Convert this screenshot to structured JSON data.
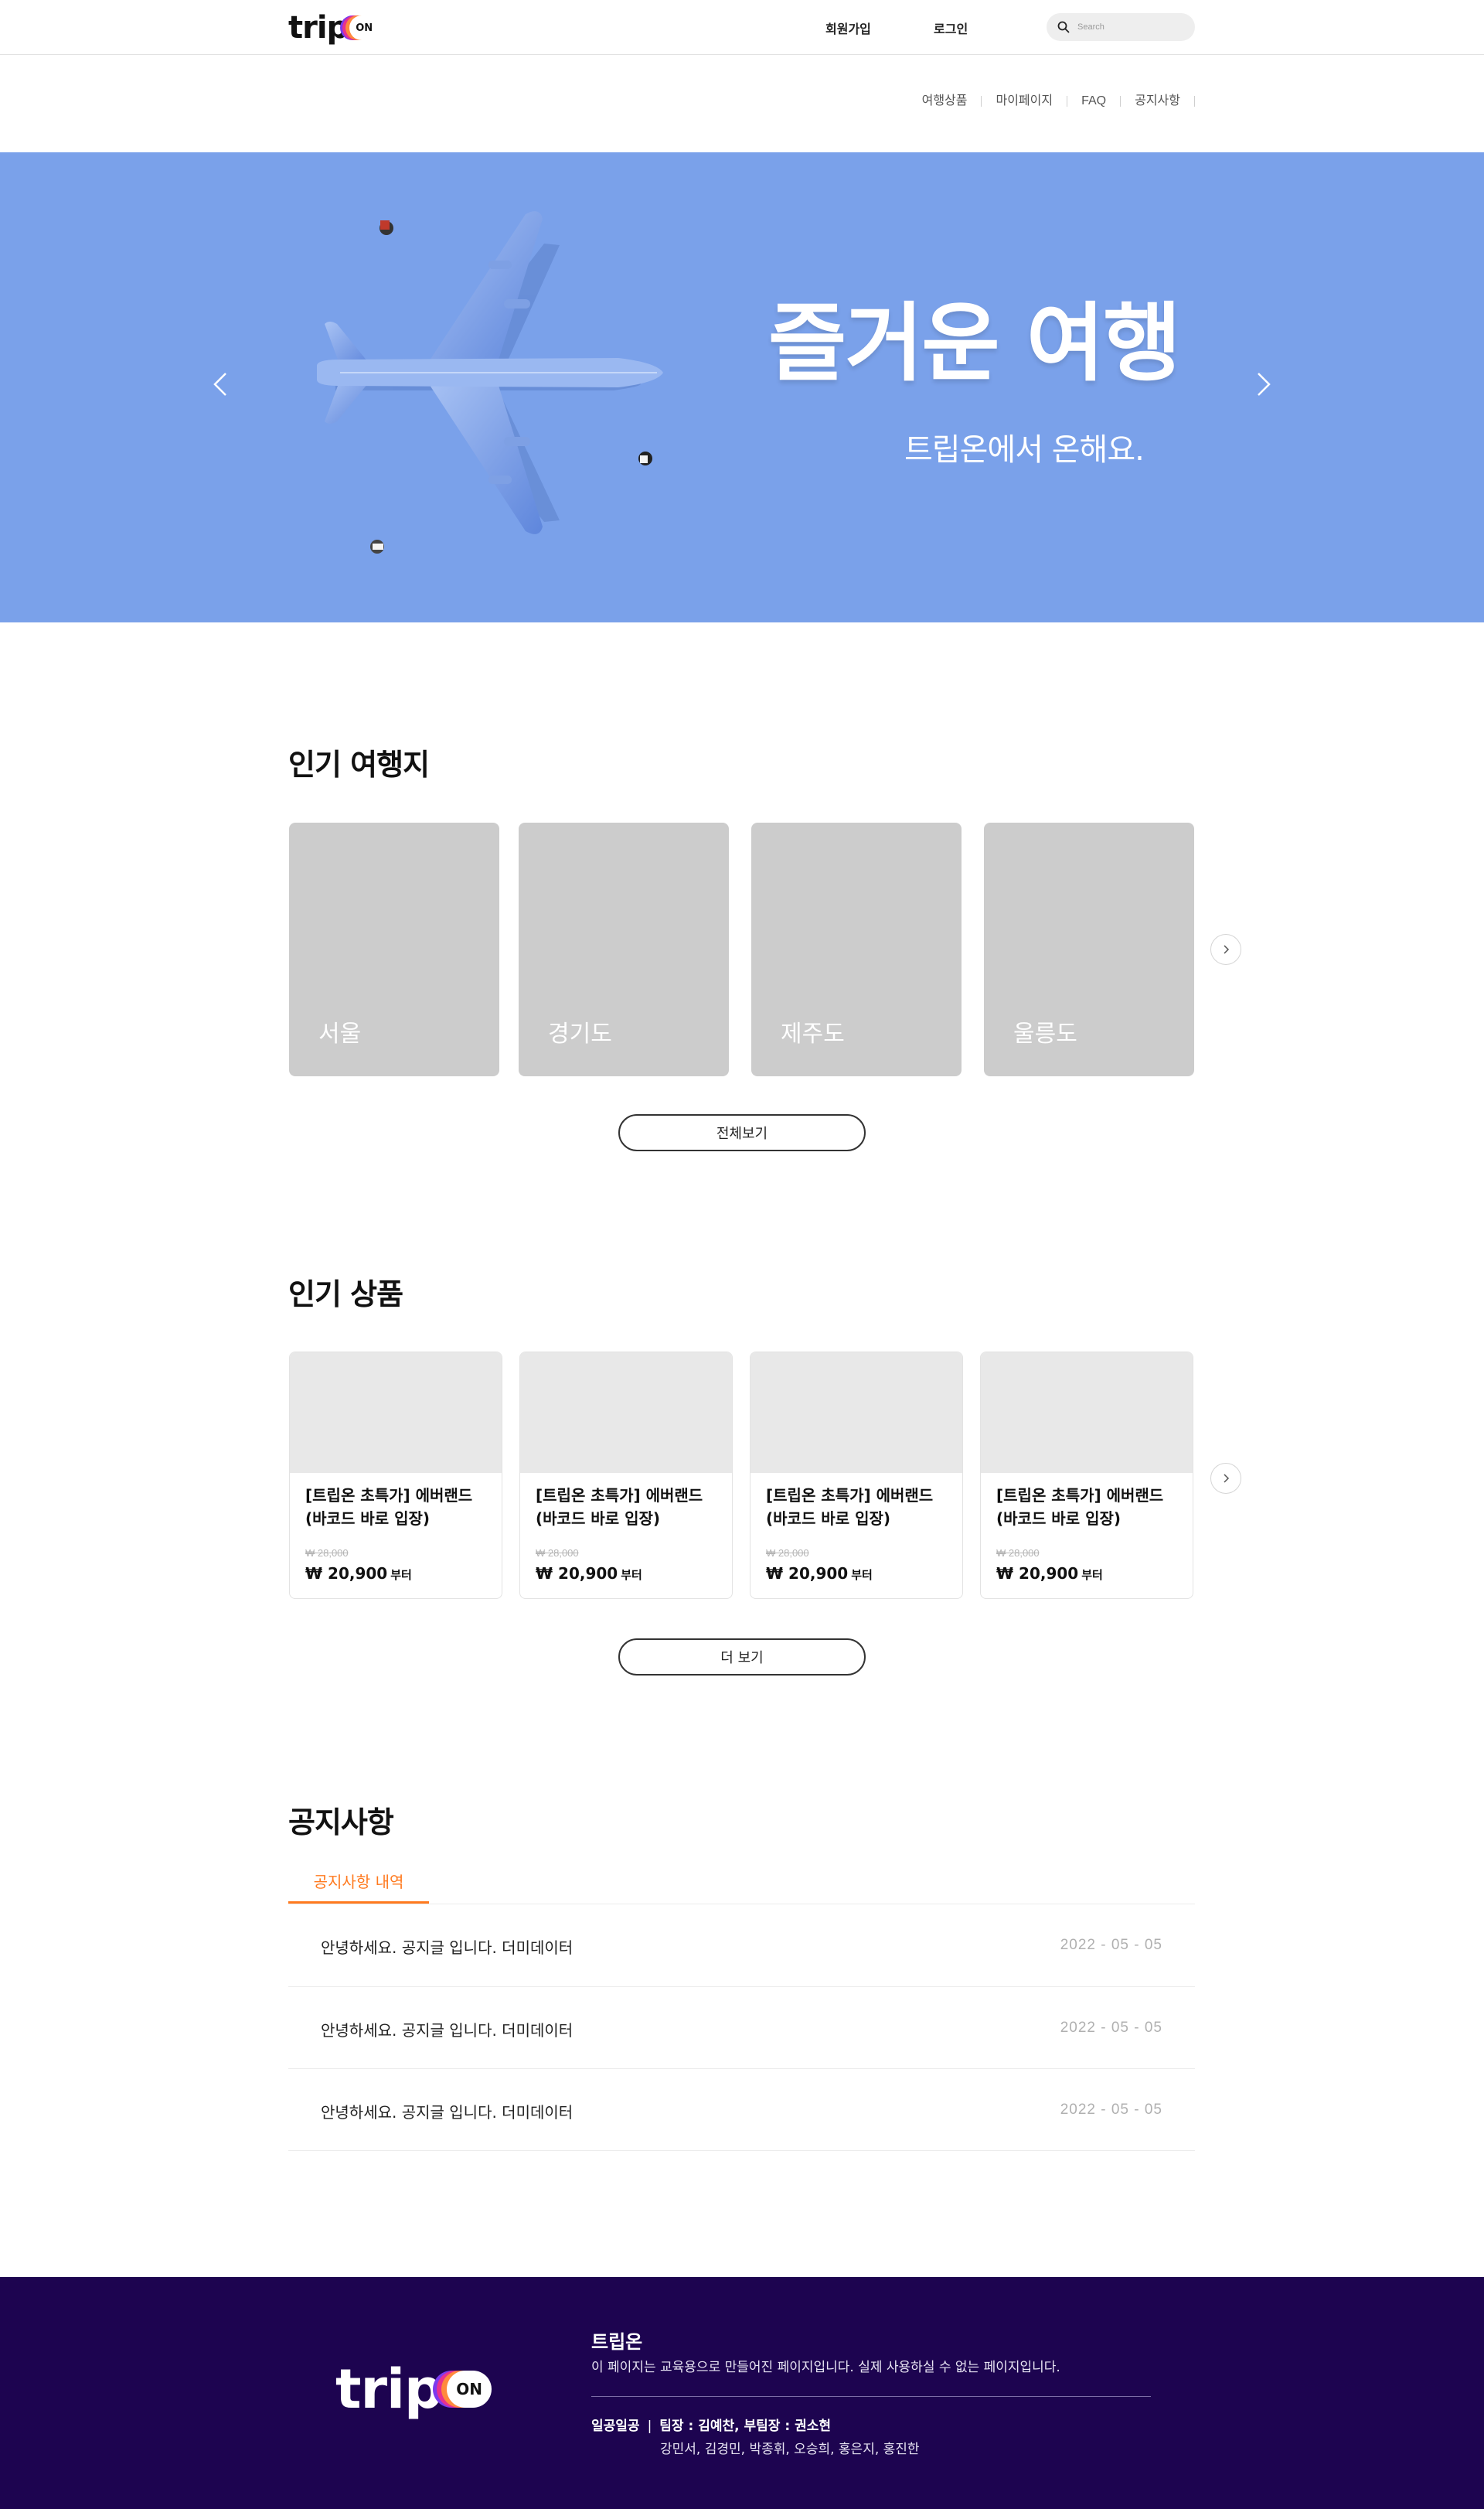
{
  "brand": {
    "logo_text": "trip",
    "logo_badge": "ON",
    "colors": {
      "orange": "#ff8a3d",
      "pink": "#e8318f",
      "purple": "#7c3aed"
    }
  },
  "header": {
    "signup": "회원가입",
    "login": "로그인",
    "search_placeholder": "Search",
    "search_icon": "search-icon"
  },
  "subnav": [
    "여행상품",
    "마이페이지",
    "FAQ",
    "공지사항"
  ],
  "hero": {
    "title": "즐거운 여행",
    "subtitle": "트립온에서 온해요.",
    "background": "#7aa1ea",
    "prev_icon": "chevron-left-icon",
    "next_icon": "chevron-right-icon"
  },
  "destinations": {
    "title": "인기 여행지",
    "items": [
      "서울",
      "경기도",
      "제주도",
      "울릉도"
    ],
    "view_all": "전체보기"
  },
  "products": {
    "title": "인기 상품",
    "items": [
      {
        "name": "[트립온 초특가] 에버랜드 (바코드 바로 입장)",
        "old_price": "₩ 28,000",
        "price": "₩ 20,900",
        "suffix": "부터"
      },
      {
        "name": "[트립온 초특가] 에버랜드 (바코드 바로 입장)",
        "old_price": "₩ 28,000",
        "price": "₩ 20,900",
        "suffix": "부터"
      },
      {
        "name": "[트립온 초특가] 에버랜드 (바코드 바로 입장)",
        "old_price": "₩ 28,000",
        "price": "₩ 20,900",
        "suffix": "부터"
      },
      {
        "name": "[트립온 초특가] 에버랜드 (바코드 바로 입장)",
        "old_price": "₩ 28,000",
        "price": "₩ 20,900",
        "suffix": "부터"
      }
    ],
    "more": "더 보기"
  },
  "notice": {
    "title": "공지사항",
    "tab": "공지사항 내역",
    "accent": "#ff7a1f",
    "rows": [
      {
        "title": "안녕하세요. 공지글 입니다. 더미데이터",
        "date": "2022 - 05 - 05"
      },
      {
        "title": "안녕하세요. 공지글 입니다. 더미데이터",
        "date": "2022 - 05 - 05"
      },
      {
        "title": "안녕하세요. 공지글 입니다. 더미데이터",
        "date": "2022 - 05 - 05"
      }
    ]
  },
  "footer": {
    "name": "트립온",
    "description": "이 페이지는 교육용으로 만들어진 페이지입니다. 실제 사용하실 수 없는 페이지입니다.",
    "team_name": "일공일공",
    "leaders": "팀장 : 김예찬, 부팀장 : 권소현",
    "members": "강민서, 김경민, 박종휘, 오승희, 홍은지, 홍진한",
    "background": "#1d0450"
  }
}
